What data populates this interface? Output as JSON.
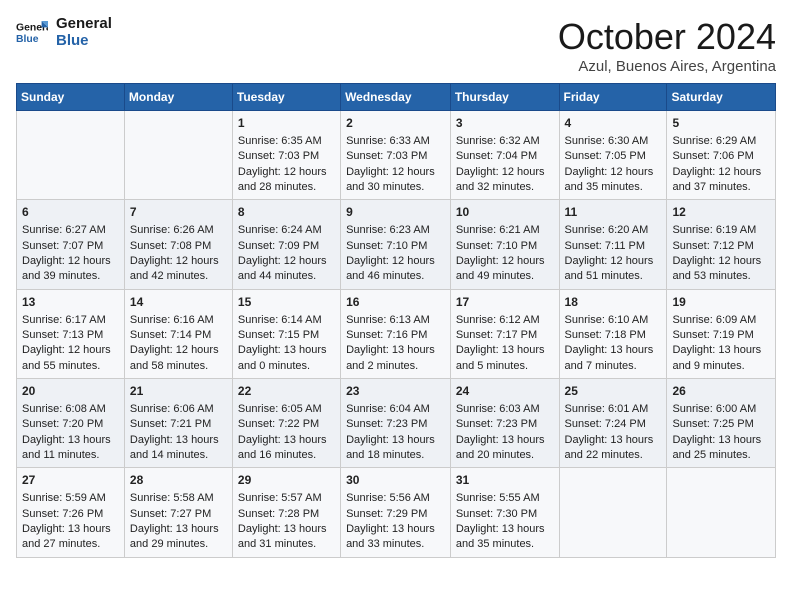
{
  "logo": {
    "line1": "General",
    "line2": "Blue"
  },
  "title": "October 2024",
  "location": "Azul, Buenos Aires, Argentina",
  "weekdays": [
    "Sunday",
    "Monday",
    "Tuesday",
    "Wednesday",
    "Thursday",
    "Friday",
    "Saturday"
  ],
  "weeks": [
    [
      {
        "day": "",
        "sunrise": "",
        "sunset": "",
        "daylight": ""
      },
      {
        "day": "",
        "sunrise": "",
        "sunset": "",
        "daylight": ""
      },
      {
        "day": "1",
        "sunrise": "Sunrise: 6:35 AM",
        "sunset": "Sunset: 7:03 PM",
        "daylight": "Daylight: 12 hours and 28 minutes."
      },
      {
        "day": "2",
        "sunrise": "Sunrise: 6:33 AM",
        "sunset": "Sunset: 7:03 PM",
        "daylight": "Daylight: 12 hours and 30 minutes."
      },
      {
        "day": "3",
        "sunrise": "Sunrise: 6:32 AM",
        "sunset": "Sunset: 7:04 PM",
        "daylight": "Daylight: 12 hours and 32 minutes."
      },
      {
        "day": "4",
        "sunrise": "Sunrise: 6:30 AM",
        "sunset": "Sunset: 7:05 PM",
        "daylight": "Daylight: 12 hours and 35 minutes."
      },
      {
        "day": "5",
        "sunrise": "Sunrise: 6:29 AM",
        "sunset": "Sunset: 7:06 PM",
        "daylight": "Daylight: 12 hours and 37 minutes."
      }
    ],
    [
      {
        "day": "6",
        "sunrise": "Sunrise: 6:27 AM",
        "sunset": "Sunset: 7:07 PM",
        "daylight": "Daylight: 12 hours and 39 minutes."
      },
      {
        "day": "7",
        "sunrise": "Sunrise: 6:26 AM",
        "sunset": "Sunset: 7:08 PM",
        "daylight": "Daylight: 12 hours and 42 minutes."
      },
      {
        "day": "8",
        "sunrise": "Sunrise: 6:24 AM",
        "sunset": "Sunset: 7:09 PM",
        "daylight": "Daylight: 12 hours and 44 minutes."
      },
      {
        "day": "9",
        "sunrise": "Sunrise: 6:23 AM",
        "sunset": "Sunset: 7:10 PM",
        "daylight": "Daylight: 12 hours and 46 minutes."
      },
      {
        "day": "10",
        "sunrise": "Sunrise: 6:21 AM",
        "sunset": "Sunset: 7:10 PM",
        "daylight": "Daylight: 12 hours and 49 minutes."
      },
      {
        "day": "11",
        "sunrise": "Sunrise: 6:20 AM",
        "sunset": "Sunset: 7:11 PM",
        "daylight": "Daylight: 12 hours and 51 minutes."
      },
      {
        "day": "12",
        "sunrise": "Sunrise: 6:19 AM",
        "sunset": "Sunset: 7:12 PM",
        "daylight": "Daylight: 12 hours and 53 minutes."
      }
    ],
    [
      {
        "day": "13",
        "sunrise": "Sunrise: 6:17 AM",
        "sunset": "Sunset: 7:13 PM",
        "daylight": "Daylight: 12 hours and 55 minutes."
      },
      {
        "day": "14",
        "sunrise": "Sunrise: 6:16 AM",
        "sunset": "Sunset: 7:14 PM",
        "daylight": "Daylight: 12 hours and 58 minutes."
      },
      {
        "day": "15",
        "sunrise": "Sunrise: 6:14 AM",
        "sunset": "Sunset: 7:15 PM",
        "daylight": "Daylight: 13 hours and 0 minutes."
      },
      {
        "day": "16",
        "sunrise": "Sunrise: 6:13 AM",
        "sunset": "Sunset: 7:16 PM",
        "daylight": "Daylight: 13 hours and 2 minutes."
      },
      {
        "day": "17",
        "sunrise": "Sunrise: 6:12 AM",
        "sunset": "Sunset: 7:17 PM",
        "daylight": "Daylight: 13 hours and 5 minutes."
      },
      {
        "day": "18",
        "sunrise": "Sunrise: 6:10 AM",
        "sunset": "Sunset: 7:18 PM",
        "daylight": "Daylight: 13 hours and 7 minutes."
      },
      {
        "day": "19",
        "sunrise": "Sunrise: 6:09 AM",
        "sunset": "Sunset: 7:19 PM",
        "daylight": "Daylight: 13 hours and 9 minutes."
      }
    ],
    [
      {
        "day": "20",
        "sunrise": "Sunrise: 6:08 AM",
        "sunset": "Sunset: 7:20 PM",
        "daylight": "Daylight: 13 hours and 11 minutes."
      },
      {
        "day": "21",
        "sunrise": "Sunrise: 6:06 AM",
        "sunset": "Sunset: 7:21 PM",
        "daylight": "Daylight: 13 hours and 14 minutes."
      },
      {
        "day": "22",
        "sunrise": "Sunrise: 6:05 AM",
        "sunset": "Sunset: 7:22 PM",
        "daylight": "Daylight: 13 hours and 16 minutes."
      },
      {
        "day": "23",
        "sunrise": "Sunrise: 6:04 AM",
        "sunset": "Sunset: 7:23 PM",
        "daylight": "Daylight: 13 hours and 18 minutes."
      },
      {
        "day": "24",
        "sunrise": "Sunrise: 6:03 AM",
        "sunset": "Sunset: 7:23 PM",
        "daylight": "Daylight: 13 hours and 20 minutes."
      },
      {
        "day": "25",
        "sunrise": "Sunrise: 6:01 AM",
        "sunset": "Sunset: 7:24 PM",
        "daylight": "Daylight: 13 hours and 22 minutes."
      },
      {
        "day": "26",
        "sunrise": "Sunrise: 6:00 AM",
        "sunset": "Sunset: 7:25 PM",
        "daylight": "Daylight: 13 hours and 25 minutes."
      }
    ],
    [
      {
        "day": "27",
        "sunrise": "Sunrise: 5:59 AM",
        "sunset": "Sunset: 7:26 PM",
        "daylight": "Daylight: 13 hours and 27 minutes."
      },
      {
        "day": "28",
        "sunrise": "Sunrise: 5:58 AM",
        "sunset": "Sunset: 7:27 PM",
        "daylight": "Daylight: 13 hours and 29 minutes."
      },
      {
        "day": "29",
        "sunrise": "Sunrise: 5:57 AM",
        "sunset": "Sunset: 7:28 PM",
        "daylight": "Daylight: 13 hours and 31 minutes."
      },
      {
        "day": "30",
        "sunrise": "Sunrise: 5:56 AM",
        "sunset": "Sunset: 7:29 PM",
        "daylight": "Daylight: 13 hours and 33 minutes."
      },
      {
        "day": "31",
        "sunrise": "Sunrise: 5:55 AM",
        "sunset": "Sunset: 7:30 PM",
        "daylight": "Daylight: 13 hours and 35 minutes."
      },
      {
        "day": "",
        "sunrise": "",
        "sunset": "",
        "daylight": ""
      },
      {
        "day": "",
        "sunrise": "",
        "sunset": "",
        "daylight": ""
      }
    ]
  ]
}
